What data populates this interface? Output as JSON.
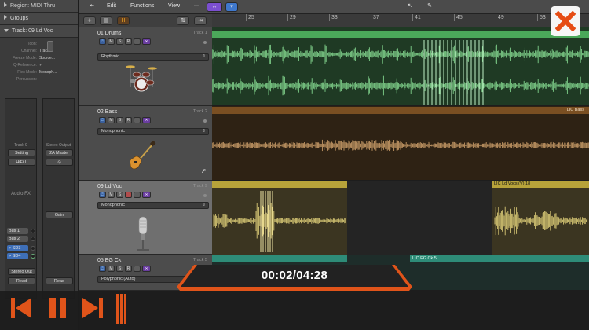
{
  "inspector": {
    "region_header": "Region: MIDI Thru",
    "groups_header": "Groups",
    "track_header": "Track:  09 Ld Voc",
    "params": [
      {
        "key": "Icon:",
        "value": ""
      },
      {
        "key": "Channel:",
        "value": "Track 9"
      },
      {
        "key": "Freeze Mode:",
        "value": "Source..."
      },
      {
        "key": "Q-Reference:",
        "value": "✓"
      },
      {
        "key": "Flex Mode:",
        "value": "Monoph..."
      },
      {
        "key": "Percussion:",
        "value": ""
      }
    ],
    "strip_a": {
      "name_top": "Track 9",
      "setting": "Setting",
      "eq": "HiFi L",
      "audio_fx": "Audio FX",
      "buses": [
        "Bus 1",
        "Bus 2",
        "> SD3",
        "> SD4"
      ],
      "output": "Stereo Out",
      "mode": "Read"
    },
    "strip_b": {
      "name_top": "Stereo Output",
      "setting": "2A Master",
      "eq": "⊙",
      "mode_label": "Gain",
      "mode": "Read"
    }
  },
  "toolbar": {
    "add_label": "+",
    "folder_label": "▤",
    "h_label": "H",
    "edit": "Edit",
    "functions": "Functions",
    "view": "View",
    "lightning": "↔",
    "arrow": "↖",
    "pencil": "✎"
  },
  "ruler": {
    "bars": [
      "25",
      "29",
      "33",
      "37",
      "41",
      "45",
      "49",
      "53"
    ]
  },
  "tracks": [
    {
      "name": "01 Drums",
      "num": "Track 1",
      "preset": "Rhythmic",
      "color": "#4ba85a"
    },
    {
      "name": "02 Bass",
      "num": "Track 2",
      "preset": "Monophonic",
      "color": "#8a5c2a"
    },
    {
      "name": "09 Ld Voc",
      "num": "Track 9",
      "preset": "Monophonic",
      "color": "#b8a43a"
    },
    {
      "name": "05 EG Ck",
      "num": "Track 5",
      "preset": "Polyphonic (Auto)",
      "color": "#2e8c78"
    }
  ],
  "regions": {
    "bass_label": "LIC Bass",
    "voc_label": "LIC Ld Vocs (V).18",
    "eg_label": "LIC EG Ck.5"
  },
  "video": {
    "time": "00:02/04:28",
    "progress": 0.008,
    "accent": "#e0541a"
  }
}
